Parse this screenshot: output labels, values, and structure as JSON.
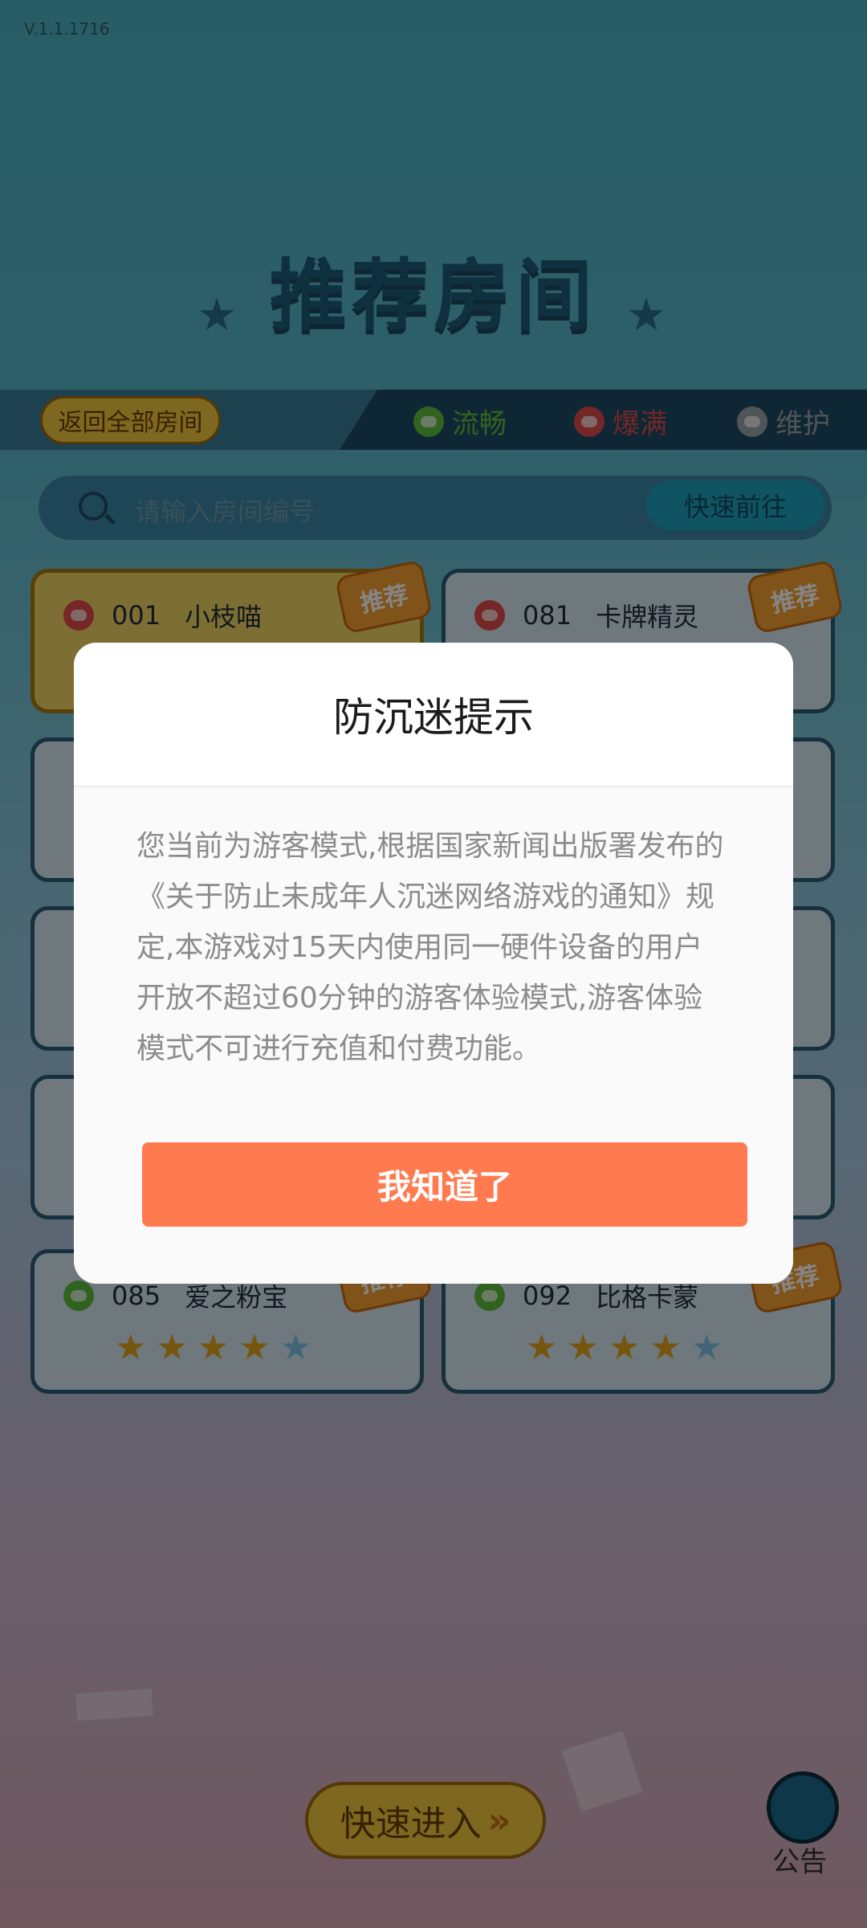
{
  "version": "V.1.1.1716",
  "header": {
    "title": "推荐房间"
  },
  "topbar": {
    "back_label": "返回全部房间",
    "status": [
      {
        "label": "流畅",
        "color": "#5fbf3f"
      },
      {
        "label": "爆满",
        "color": "#e04b4b"
      },
      {
        "label": "维护",
        "color": "#9aa4aa"
      }
    ]
  },
  "search": {
    "placeholder": "请输入房间编号",
    "go_label": "快速前往"
  },
  "rooms": [
    {
      "no": "001",
      "name": "小枝喵",
      "tag": "推荐",
      "status": "爆满"
    },
    {
      "no": "081",
      "name": "卡牌精灵",
      "tag": "推荐",
      "status": "爆满"
    },
    {
      "no": "085",
      "name": "爱之粉宝",
      "tag": "推荐",
      "status": "流畅",
      "stars": 4
    },
    {
      "no": "092",
      "name": "比格卡蒙",
      "tag": "推荐",
      "status": "流畅",
      "stars": 4
    }
  ],
  "footer": {
    "quick_enter": "快速进入",
    "notice": "公告"
  },
  "modal": {
    "title": "防沉迷提示",
    "body": "您当前为游客模式,根据国家新闻出版署发布的《关于防止未成年人沉迷网络游戏的通知》规定,本游戏对15天内使用同一硬件设备的用户开放不超过60分钟的游客体验模式,游客体验模式不可进行充值和付费功能。",
    "ok_label": "我知道了"
  }
}
